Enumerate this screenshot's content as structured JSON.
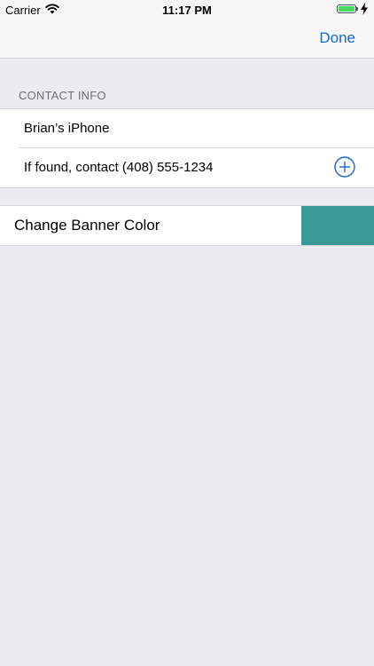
{
  "status_bar": {
    "carrier": "Carrier",
    "time": "11:17 PM",
    "wifi_icon": "wifi-icon",
    "battery_color": "#4cd964",
    "charging_icon": "bolt-icon"
  },
  "nav_bar": {
    "done_label": "Done",
    "accent_color": "#1769c9"
  },
  "contact_info": {
    "header": "CONTACT INFO",
    "device_name": "Brian’s iPhone",
    "message": "If found, contact (408) 555-1234",
    "add_icon": "plus-circle-icon"
  },
  "banner": {
    "label": "Change Banner Color",
    "color": "#3a9a98"
  }
}
